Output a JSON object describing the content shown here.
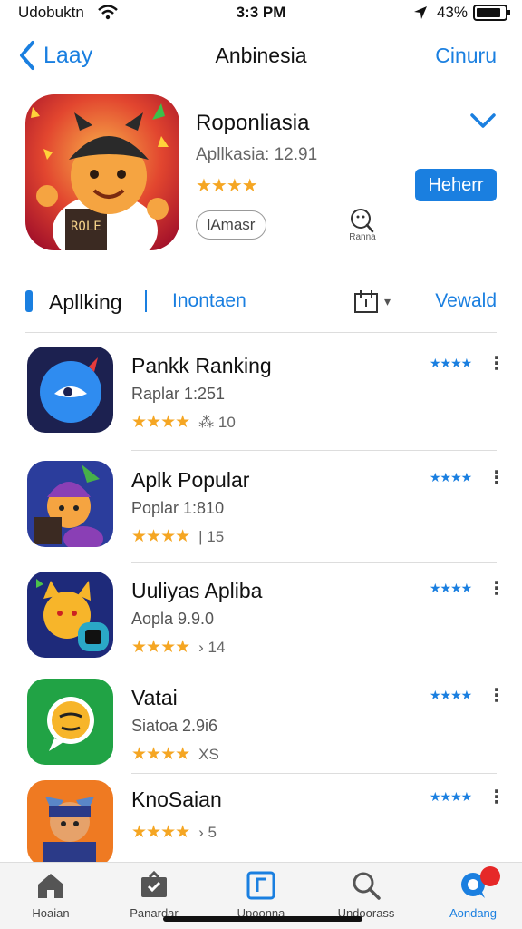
{
  "status": {
    "carrier": "Udobuktn",
    "time": "3:3 PM",
    "battery": "43%",
    "battery_level": 0.85
  },
  "nav": {
    "back_label": "Laay",
    "title": "Anbinesia",
    "right_label": "Cinuru"
  },
  "featured": {
    "name": "Roponliasia",
    "subtitle": "Apllkasia: 12.91",
    "stars": "★★★★",
    "get_label": "Heherr",
    "pill_label": "lAmasr",
    "search_label": "Ranna",
    "icon_text": "ROLE"
  },
  "tabs": {
    "active": "Apllking",
    "other": "Inontaen",
    "right": "Vewald"
  },
  "apps": [
    {
      "name": "Pankk Ranking",
      "sub": "Raplar 1:251",
      "stars": "★★★★",
      "count": "⁂ 10",
      "mini": "★★★★"
    },
    {
      "name": "Aplk Popular",
      "sub": "Poplar 1:810",
      "stars": "★★★★",
      "count": "| 15",
      "mini": "★★★★"
    },
    {
      "name": "Uuliyas Apliba",
      "sub": "Aopla 9.9.0",
      "stars": "★★★★",
      "count": "› 14",
      "mini": "★★★★"
    },
    {
      "name": "Vatai",
      "sub": "Siatoa 2.9i6",
      "stars": "★★★★",
      "count": "XS",
      "mini": "★★★★"
    },
    {
      "name": "KnoSaian",
      "sub": "",
      "stars": "★★★★",
      "count": "› 5",
      "mini": "★★★★"
    }
  ],
  "tabbar": [
    {
      "label": "Hoaian",
      "icon": "home-icon"
    },
    {
      "label": "Panardar",
      "icon": "box-icon"
    },
    {
      "label": "Upoonna",
      "icon": "app-icon"
    },
    {
      "label": "Undoorass",
      "icon": "search-icon"
    },
    {
      "label": "Aondang",
      "icon": "chat-icon",
      "badge": ""
    }
  ],
  "colors": {
    "accent": "#1a7fe0",
    "star": "#f5a623",
    "badge": "#e62828"
  }
}
